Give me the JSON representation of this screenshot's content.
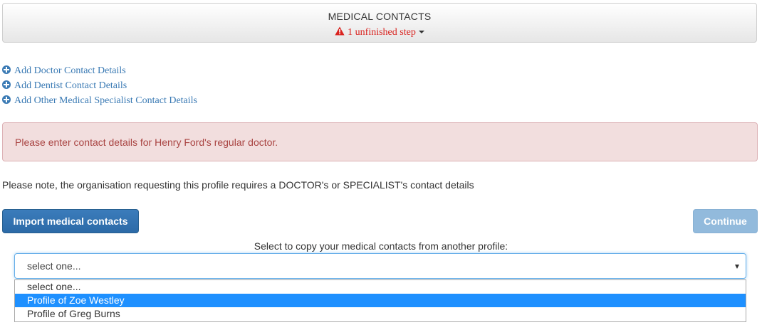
{
  "header": {
    "title": "MEDICAL CONTACTS",
    "status": "1 unfinished step",
    "status_color": "#d9231f"
  },
  "links": [
    {
      "label": "Add Doctor Contact Details"
    },
    {
      "label": "Add Dentist Contact Details"
    },
    {
      "label": "Add Other Medical Specialist Contact Details"
    }
  ],
  "alert": {
    "text": "Please enter contact details for Henry Ford's regular doctor."
  },
  "note": "Please note, the organisation requesting this profile requires a DOCTOR's or SPECIALIST's contact details",
  "buttons": {
    "import_label": "Import medical contacts",
    "continue_label": "Continue"
  },
  "copy_select": {
    "label": "Select to copy your medical contacts from another profile:",
    "value": "select one...",
    "options": [
      "select one...",
      "Profile of Zoe Westley",
      "Profile of Greg Burns"
    ],
    "highlighted_option": "Profile of Zoe Westley"
  },
  "colors": {
    "link": "#3a7ab4",
    "alert_bg": "#f2dede",
    "alert_text": "#a94442",
    "primary_button": "#337ab7",
    "option_highlight": "#1e90ff"
  }
}
